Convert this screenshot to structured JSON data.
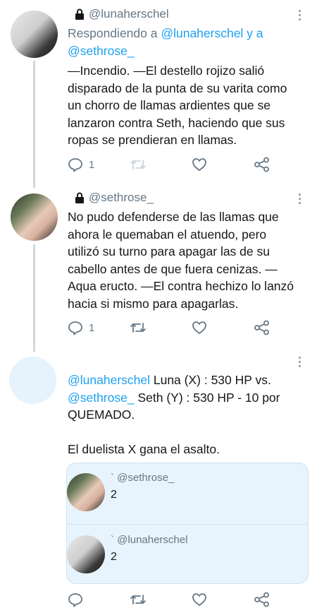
{
  "tweets": [
    {
      "username": "@lunaherschel",
      "reply_prefix": "Respondiendo a ",
      "reply_users": "@lunaherschel y a",
      "reply_users2": "@sethrose_",
      "lines": [
        "—Incendio. —El destello rojizo salió",
        "disparado de la punta de su varita como",
        "un chorro de llamas ardientes que se",
        "lanzaron contra Seth, haciendo que sus",
        "ropas se prendieran en llamas."
      ],
      "reply_count": "1"
    },
    {
      "username": "@sethrose_",
      "lines": [
        "No pudo defenderse de las llamas que",
        "ahora le quemaban el atuendo, pero",
        "utilizó su turno para apagar las de su",
        "cabello antes de que fuera cenizas. —",
        "Aqua eructo. —El contra hechizo lo lanzó",
        "hacia si mismo para apagarlas."
      ],
      "reply_count": "1"
    },
    {
      "line1_link": "@lunaherschel",
      "line1_rest": " Luna (X) : 530 HP vs.",
      "line2_link": "@sethrose_",
      "line2_rest": " Seth (Y) : 530 HP - 10 por",
      "line3": "QUEMADO.",
      "line4": "El duelista X gana el asalto."
    }
  ],
  "quote": {
    "items": [
      {
        "username": "` @sethrose_",
        "text": "2"
      },
      {
        "username": "` @lunaherschel",
        "text": "2"
      }
    ]
  },
  "colors": {
    "accent": "#1da1f2",
    "muted": "#657786",
    "thread_line": "#cfd9de",
    "quote_bg": "#e8f4fd"
  },
  "icons": [
    "lock-icon",
    "more-icon",
    "reply-icon",
    "retweet-icon",
    "like-icon",
    "share-icon"
  ]
}
